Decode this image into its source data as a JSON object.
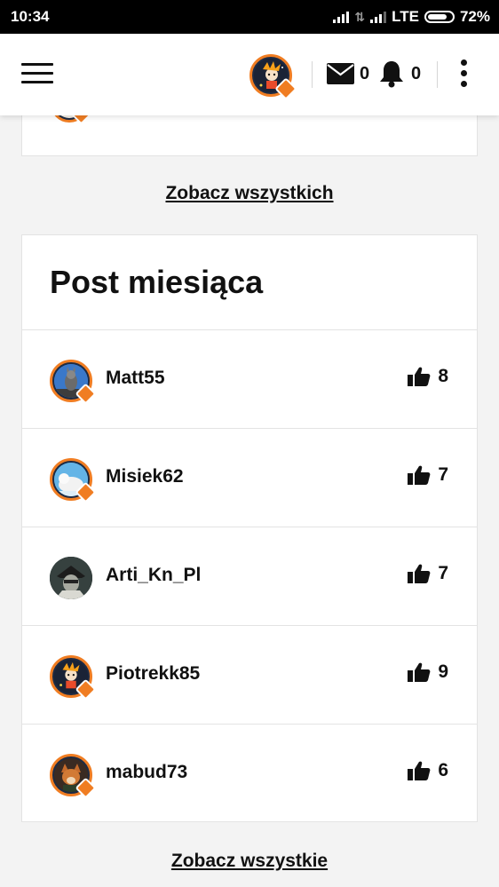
{
  "status": {
    "time": "10:34",
    "network": "LTE",
    "battery": "72%"
  },
  "header": {
    "messages_count": "0",
    "notifications_count": "0"
  },
  "links": {
    "see_all_top": "Zobacz wszystkich",
    "see_all_bottom": "Zobacz wszystkie"
  },
  "post_of_month": {
    "title": "Post miesiąca",
    "items": [
      {
        "username": "Matt55",
        "likes": "8"
      },
      {
        "username": "Misiek62",
        "likes": "7"
      },
      {
        "username": "Arti_Kn_Pl",
        "likes": "7"
      },
      {
        "username": "Piotrekk85",
        "likes": "9"
      },
      {
        "username": "mabud73",
        "likes": "6"
      }
    ]
  },
  "colors": {
    "accent": "#f07d22",
    "text": "#111111",
    "background": "#f3f3f3"
  }
}
